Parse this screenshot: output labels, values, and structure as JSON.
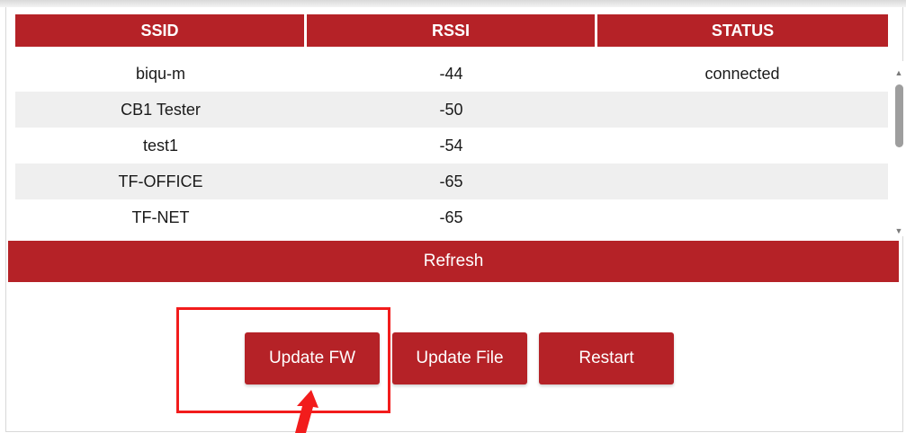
{
  "wifi_table": {
    "headers": {
      "ssid": "SSID",
      "rssi": "RSSI",
      "status": "STATUS"
    },
    "rows": [
      {
        "ssid": "biqu-m",
        "rssi": "-44",
        "status": "connected"
      },
      {
        "ssid": "CB1 Tester",
        "rssi": "-50",
        "status": ""
      },
      {
        "ssid": "test1",
        "rssi": "-54",
        "status": ""
      },
      {
        "ssid": "TF-OFFICE",
        "rssi": "-65",
        "status": ""
      },
      {
        "ssid": "TF-NET",
        "rssi": "-65",
        "status": ""
      }
    ]
  },
  "actions": {
    "refresh_label": "Refresh",
    "update_fw_label": "Update FW",
    "update_file_label": "Update File",
    "restart_label": "Restart"
  },
  "colors": {
    "accent": "#b52227",
    "annotation": "#f21c1c"
  },
  "icons": {
    "scroll_up": "triangle-up-icon",
    "scroll_down": "triangle-down-icon",
    "annotation_arrow": "arrow-annotation"
  }
}
